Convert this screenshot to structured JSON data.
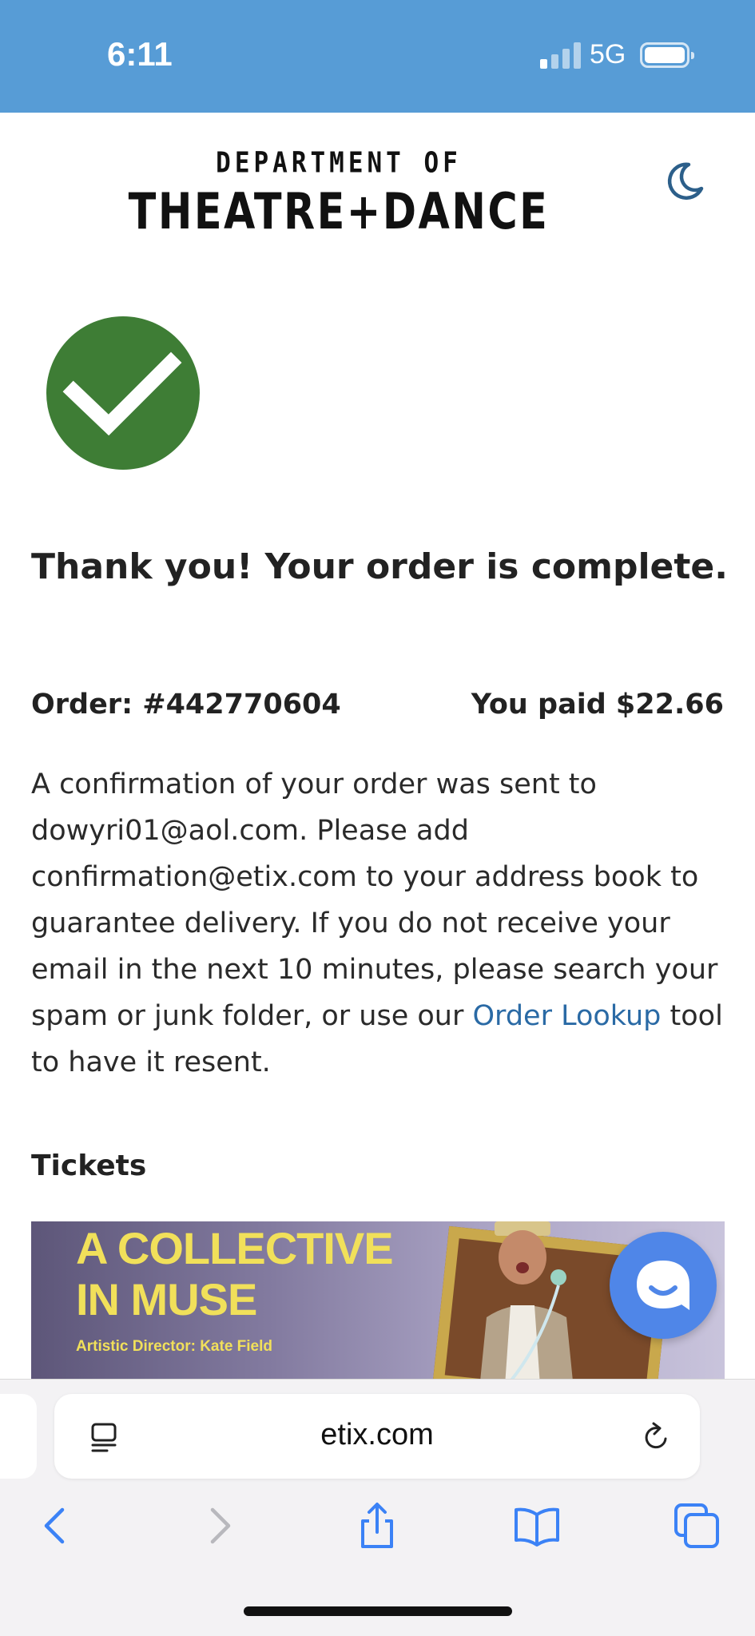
{
  "status_bar": {
    "time": "6:11",
    "network": "5G",
    "signal_bars_active": 1,
    "signal_bars_total": 4,
    "battery_level": 1.0
  },
  "header": {
    "logo_line1": "DEPARTMENT OF",
    "logo_line2": "THEATRE+DANCE",
    "dark_mode_icon": "moon-icon"
  },
  "confirmation": {
    "status_icon": "check-icon",
    "heading": "Thank you! Your order is complete.",
    "order_label": "Order: #442770604",
    "paid_label": "You paid $22.66",
    "message_part1": "A confirmation of your order was sent to dowyri01@aol.com. Please add confirmation@etix.com to your address book to guarantee delivery. If you do not receive your email in the next 10 minutes, please search your spam or junk folder, or use our ",
    "message_link": "Order Lookup",
    "message_part2": " tool to have it resent."
  },
  "tickets": {
    "heading": "Tickets",
    "banner_title": "A COLLECTIVE\nIN MUSE",
    "banner_subtitle": "Artistic Director: Kate Field"
  },
  "chat": {
    "icon": "chat-icon"
  },
  "browser": {
    "url": "etix.com",
    "toolbar_icons": [
      "back-icon",
      "forward-icon",
      "share-icon",
      "bookmarks-icon",
      "tabs-icon"
    ]
  },
  "colors": {
    "status_bar_bg": "#579cd6",
    "success_green": "#3e7d35",
    "link_blue": "#2a6aa5",
    "chat_blue": "#4f86e8",
    "banner_yellow": "#f1e05a",
    "safari_blue": "#3b82f6"
  }
}
